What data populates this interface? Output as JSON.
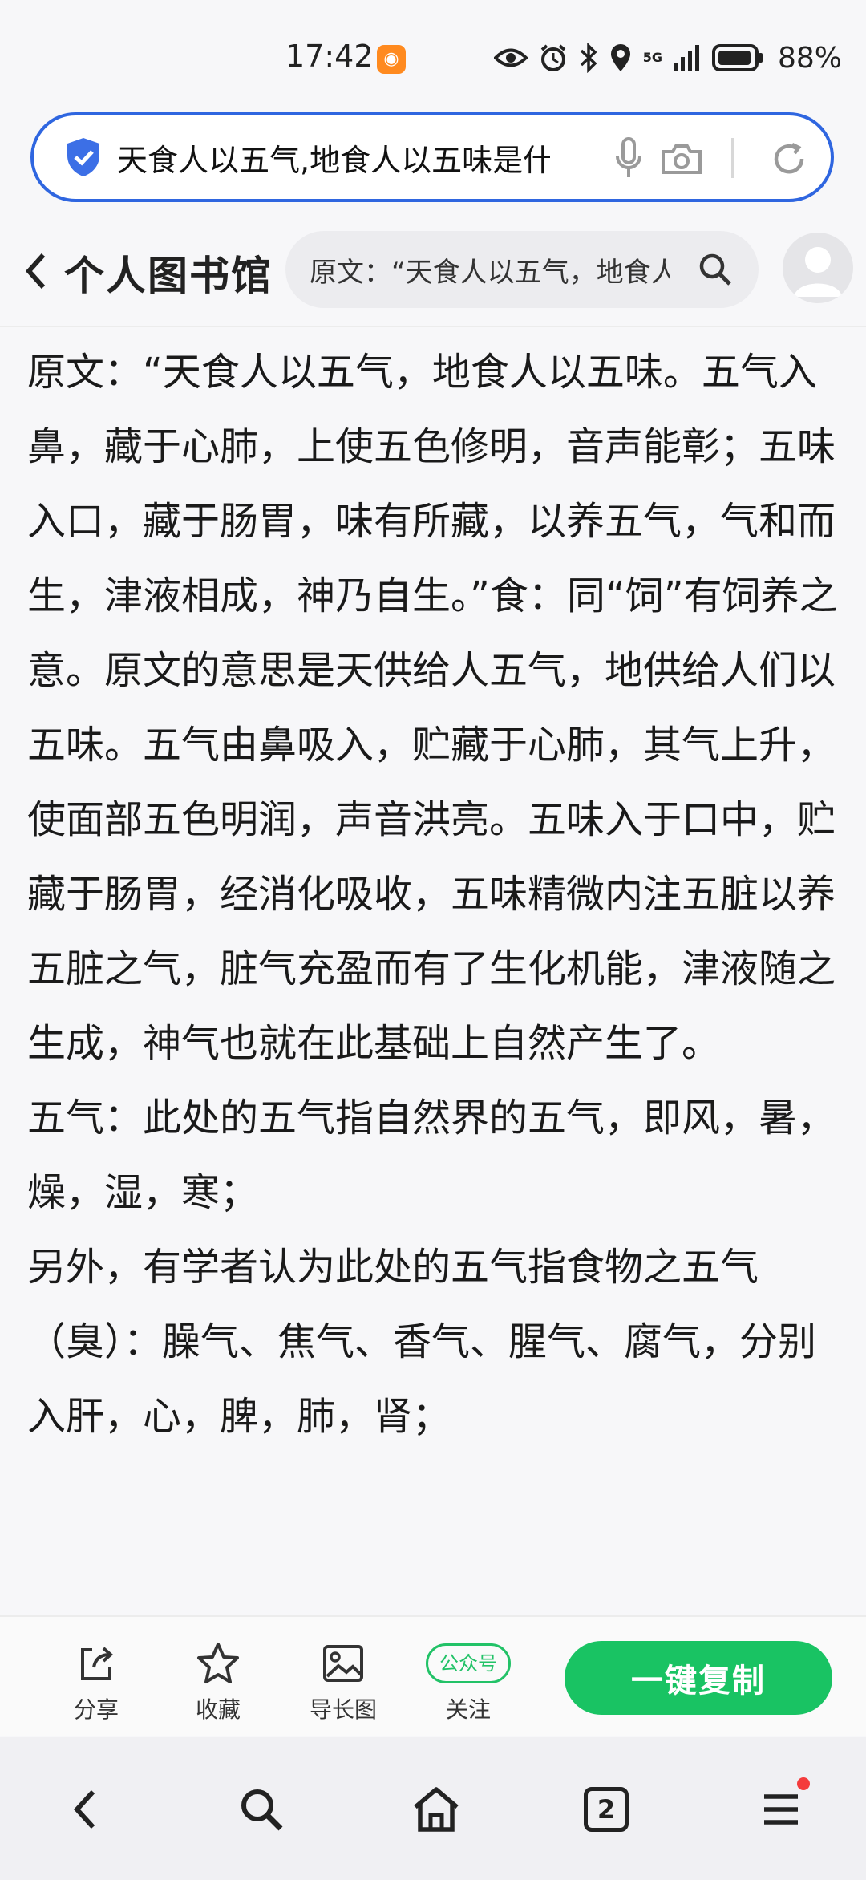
{
  "status_bar": {
    "time": "17:42",
    "network": "5G",
    "battery": "88%"
  },
  "address_bar": {
    "query": "天食人以五气,地食人以五味是什么意思"
  },
  "site": {
    "logo": "个人图书馆",
    "search_text": "原文：“天食人以五气，地食人以五味。"
  },
  "article": {
    "paragraphs": [
      "原文：“天食人以五气，地食人以五味。五气入鼻，藏于心肺，上使五色修明，音声能彰；五味入口，藏于肠胃，味有所藏，以养五气，气和而生，津液相成，神乃自生。”食：同“饲”有饲养之意。原文的意思是天供给人五气，地供给人们以五味。五气由鼻吸入，贮藏于心肺，其气上升，使面部五色明润，声音洪亮。五味入于口中，贮藏于肠胃，经消化吸收，五味精微内注五脏以养五脏之气，脏气充盈而有了生化机能，津液随之生成，神气也就在此基础上自然产生了。",
      "五气：此处的五气指自然界的五气，即风，暑，燥，湿，寒；",
      "另外，有学者认为此处的五气指食物之五气（臭）：臊气、焦气、香气、腥气、腐气，分别入肝，心，脾，肺，肾；"
    ]
  },
  "action_bar": {
    "share": "分享",
    "favorite": "收藏",
    "long_image": "导长图",
    "follow_badge": "公众号",
    "follow": "关注",
    "copy": "一键复制"
  },
  "bottom_nav": {
    "tab_count": "2"
  },
  "colors": {
    "address_border": "#2f66e0",
    "accent_green": "#19c363",
    "notify_dot": "#f43c3c"
  }
}
